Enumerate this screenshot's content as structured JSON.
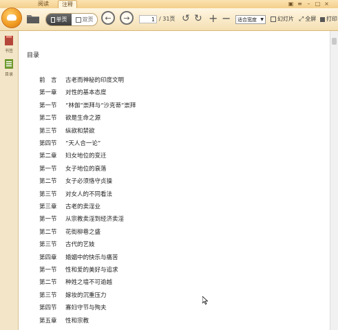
{
  "tabs": [
    {
      "label": "阅读",
      "active": false
    },
    {
      "label": "注释",
      "active": true
    }
  ],
  "toolbar": {
    "view_single": "单页",
    "view_double": "双页",
    "page_current": "1",
    "page_total": "/ 31页",
    "zoom": "适合宽度",
    "slideshow": "幻灯片",
    "fullscreen": "全屏",
    "print": "打印"
  },
  "sidebar": {
    "items": [
      {
        "label": "书签",
        "icon": "bookmark-icon"
      },
      {
        "label": "目录",
        "icon": "toc-icon"
      }
    ]
  },
  "document": {
    "title": "目录",
    "toc": [
      {
        "num": "前　言",
        "title": "古老而神秘的印度文明"
      },
      {
        "num": "第一章",
        "title": "对性的基本态度"
      },
      {
        "num": "第一节",
        "title": "“林伽”崇拜与“沙克蒂”崇拜"
      },
      {
        "num": "第二节",
        "title": "欲是生命之源"
      },
      {
        "num": "第三节",
        "title": "纵欲和禁欲"
      },
      {
        "num": "第四节",
        "title": "“天人合一论”"
      },
      {
        "num": "第二章",
        "title": "妇女地位的变迁"
      },
      {
        "num": "第一节",
        "title": "女子地位的衰落"
      },
      {
        "num": "第二节",
        "title": "女子必须恪守贞操"
      },
      {
        "num": "第三节",
        "title": "对女人的不同看法"
      },
      {
        "num": "第三章",
        "title": "古老的卖淫业"
      },
      {
        "num": "第一节",
        "title": "从宗教卖淫到经济卖淫"
      },
      {
        "num": "第二节",
        "title": "花街柳巷之盛"
      },
      {
        "num": "第三节",
        "title": "古代的艺妓"
      },
      {
        "num": "第四章",
        "title": "婚姻中的快乐与痛苦"
      },
      {
        "num": "第一节",
        "title": "性和爱的美好与追求"
      },
      {
        "num": "第二节",
        "title": "种姓之墙不可逾越"
      },
      {
        "num": "第三节",
        "title": "嫁妆的沉重压力"
      },
      {
        "num": "第四节",
        "title": "寡妇守节与殉夫"
      },
      {
        "num": "第五章",
        "title": "性和宗教"
      }
    ]
  },
  "colors": {
    "accent": "#f09a20",
    "toolbar_bg": "#f4dfb2",
    "sidebar_bg": "#f3e6c8"
  }
}
